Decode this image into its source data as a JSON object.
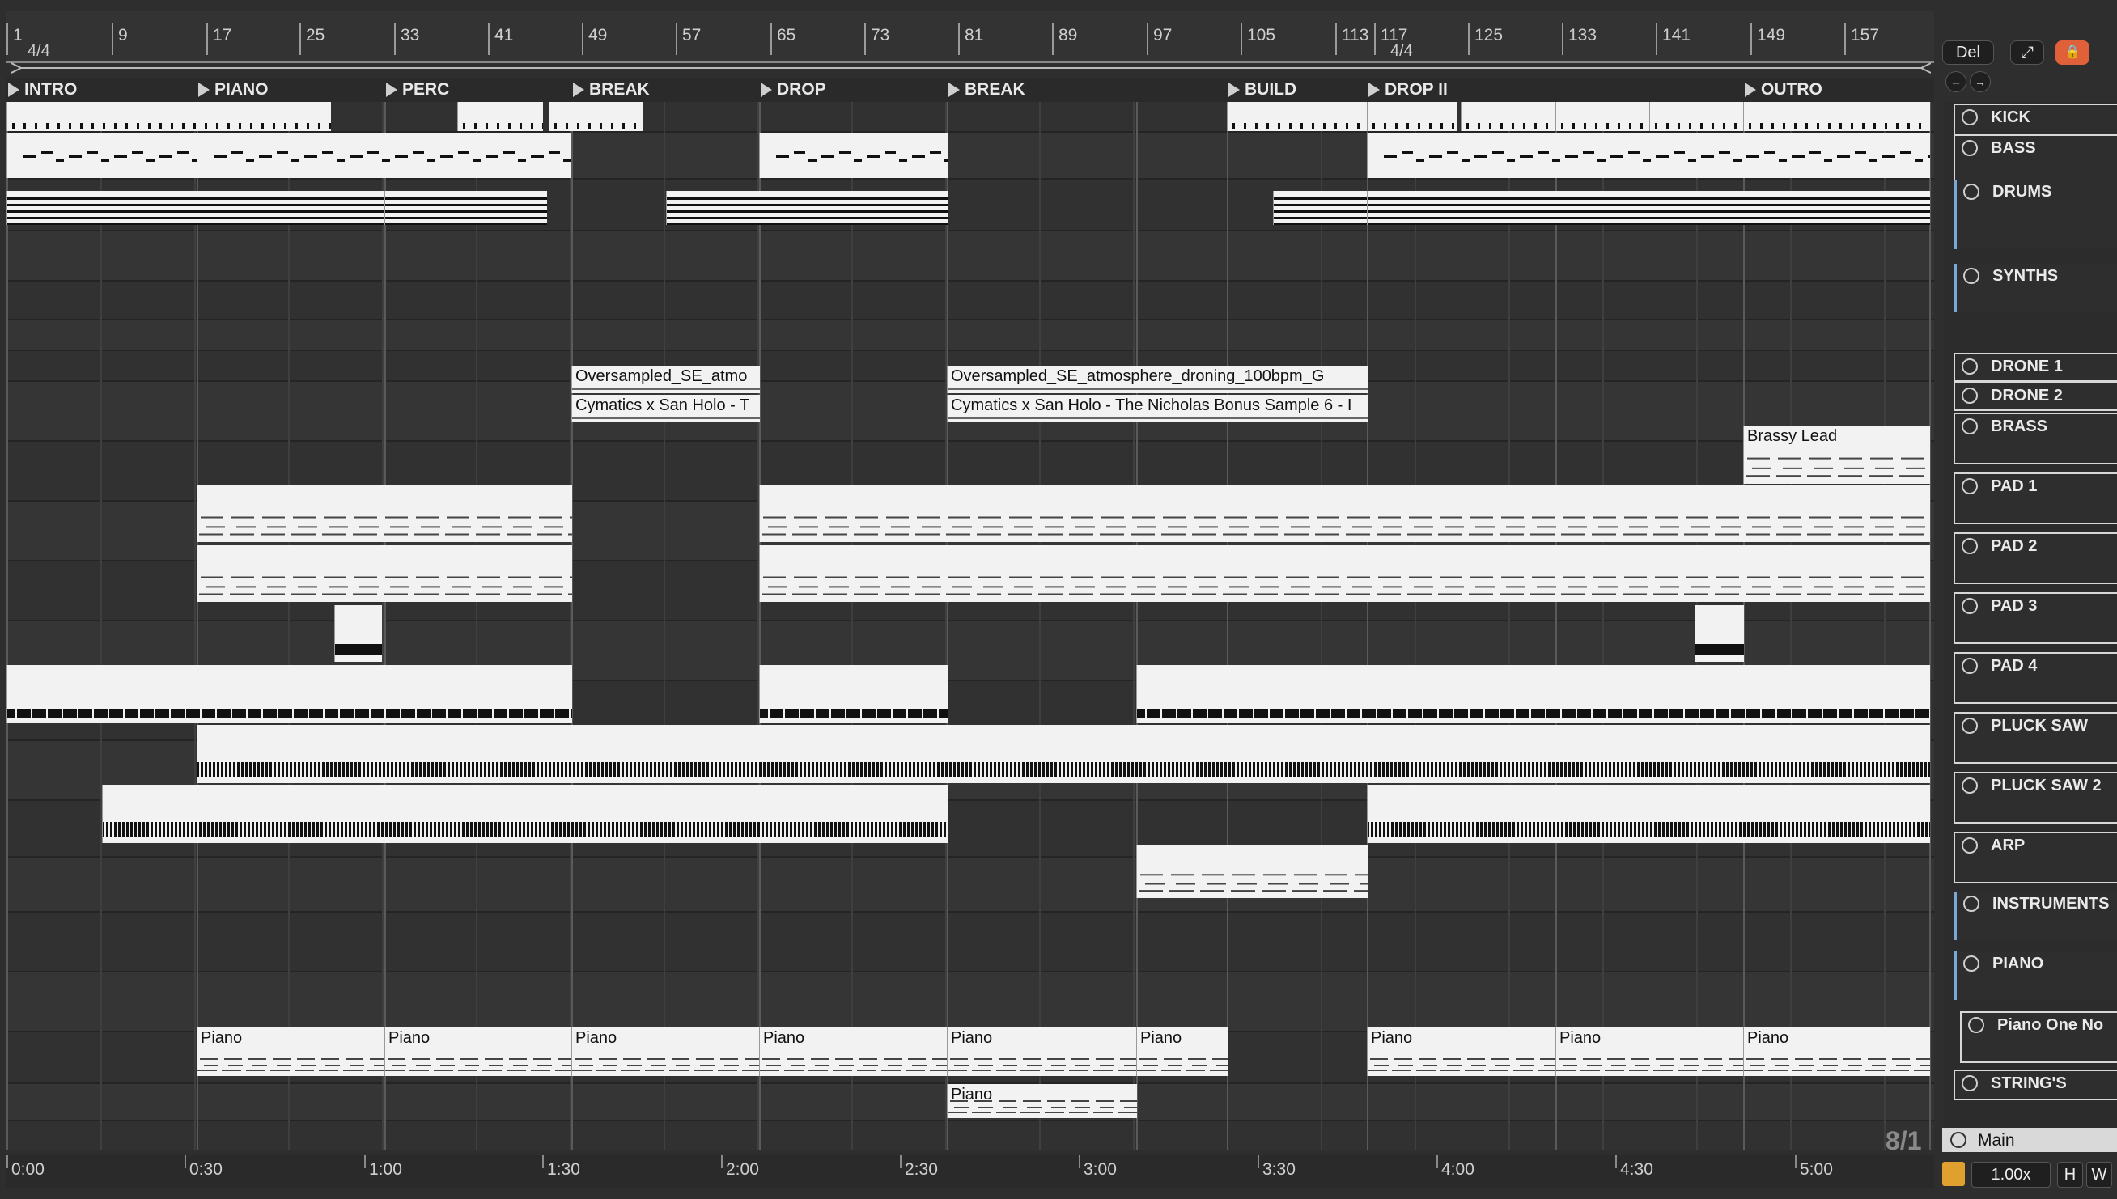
{
  "ruler": {
    "bars": [
      "1",
      "9",
      "17",
      "25",
      "33",
      "41",
      "49",
      "57",
      "65",
      "73",
      "81",
      "89",
      "97",
      "105",
      "113",
      "117",
      "125",
      "133",
      "141",
      "149",
      "157"
    ],
    "time_signatures": [
      "4/4",
      "4/4"
    ]
  },
  "locators": [
    "INTRO",
    "PIANO",
    "PERC",
    "BREAK",
    "DROP",
    "BREAK",
    "BUILD",
    "DROP II",
    "OUTRO"
  ],
  "clip_names": {
    "atmo_short": "Oversampled_SE_atmo",
    "atmo_long": "Oversampled_SE_atmosphere_droning_100bpm_G",
    "cymatics_short": "Cymatics x San Holo - T",
    "cymatics_long": "Cymatics x San Holo - The Nicholas Bonus Sample 6 - I",
    "brassy": "Brassy Lead",
    "piano": "Piano"
  },
  "tracks": [
    {
      "label": "KICK",
      "icon": "play-icon"
    },
    {
      "label": "BASS",
      "icon": "fold-icon"
    },
    {
      "label": "DRUMS",
      "icon": "group-icon"
    },
    {
      "label": "SYNTHS",
      "icon": "group-icon"
    },
    {
      "label": "DRONE 1",
      "icon": "play-icon"
    },
    {
      "label": "DRONE 2",
      "icon": "play-icon"
    },
    {
      "label": "BRASS",
      "icon": "fold-icon"
    },
    {
      "label": "PAD 1",
      "icon": "fold-icon"
    },
    {
      "label": "PAD 2",
      "icon": "fold-icon"
    },
    {
      "label": "PAD 3",
      "icon": "fold-icon"
    },
    {
      "label": "PAD 4",
      "icon": "fold-icon"
    },
    {
      "label": "PLUCK SAW",
      "icon": "fold-icon"
    },
    {
      "label": "PLUCK SAW 2",
      "icon": "fold-icon"
    },
    {
      "label": "ARP",
      "icon": "fold-icon"
    },
    {
      "label": "INSTRUMENTS",
      "icon": "group-icon"
    },
    {
      "label": "PIANO",
      "icon": "group-icon"
    },
    {
      "label": "Piano One No",
      "icon": "fold-icon"
    },
    {
      "label": "STRING'S",
      "icon": "fold-icon"
    }
  ],
  "main_track": "Main",
  "buttons": {
    "del": "Del",
    "expand": "⤢",
    "lock": "🔒",
    "back": "←",
    "fwd": "→"
  },
  "grid": "8/1",
  "zoom": "1.00x",
  "h_btn": "H",
  "w_btn": "W",
  "time_labels": [
    "0:00",
    "0:30",
    "1:00",
    "1:30",
    "2:00",
    "2:30",
    "3:00",
    "3:30",
    "4:00",
    "4:30",
    "5:00"
  ],
  "colors": {
    "accent": "#7aa7d8",
    "lock": "#e0603a"
  }
}
